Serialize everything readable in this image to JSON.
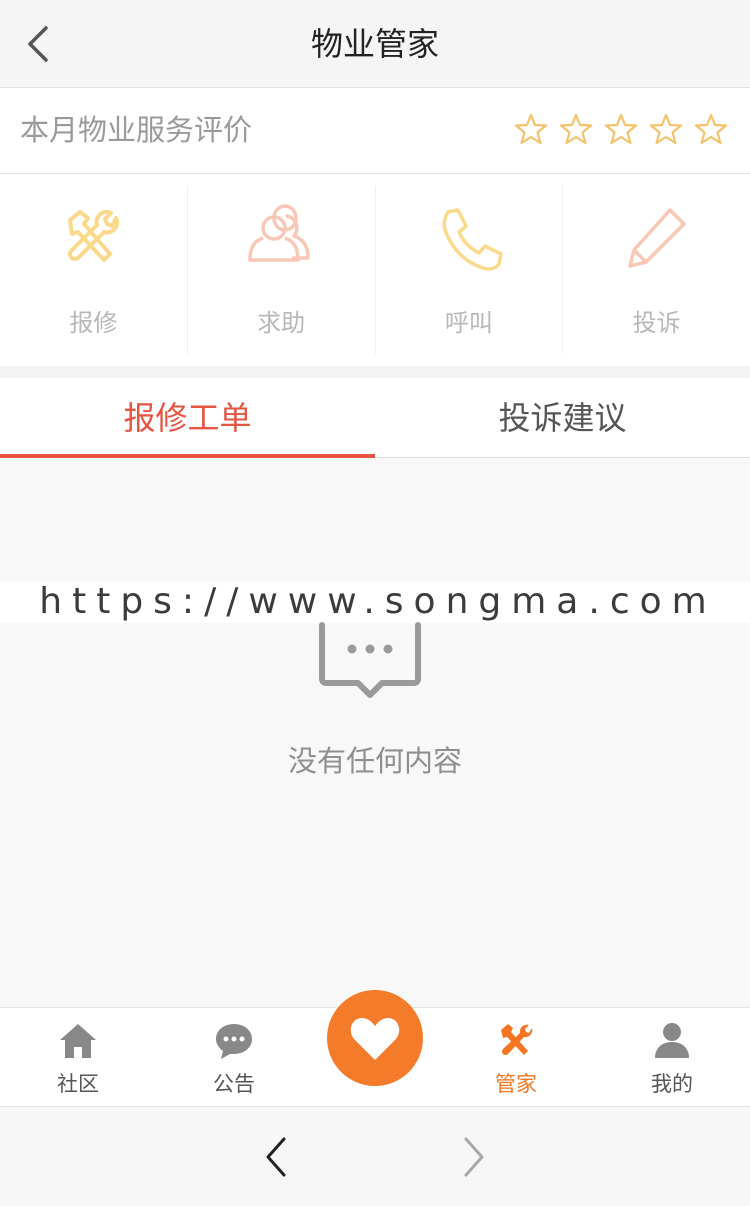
{
  "header": {
    "title": "物业管家",
    "back_icon": "chevron-left-icon"
  },
  "rating": {
    "label": "本月物业服务评价",
    "stars_total": 5,
    "stars_filled": 0,
    "star_color": "#f5c26b"
  },
  "services": [
    {
      "label": "报修",
      "icon": "repair-tools-icon",
      "color": "#fbd98a"
    },
    {
      "label": "求助",
      "icon": "users-icon",
      "color": "#f8c7b5"
    },
    {
      "label": "呼叫",
      "icon": "phone-icon",
      "color": "#fbd98a"
    },
    {
      "label": "投诉",
      "icon": "pencil-icon",
      "color": "#f8c7b5"
    }
  ],
  "tabs": [
    {
      "label": "报修工单",
      "active": true
    },
    {
      "label": "投诉建议",
      "active": false
    }
  ],
  "watermark": "https://www.songma.com",
  "empty_state": {
    "text": "没有任何内容",
    "icon": "message-dots-icon"
  },
  "tabbar": {
    "items": [
      {
        "label": "社区",
        "icon": "home-icon",
        "active": false
      },
      {
        "label": "公告",
        "icon": "chat-bubble-icon",
        "active": false
      },
      {
        "label": "管家",
        "icon": "repair-tools-icon",
        "active": true
      },
      {
        "label": "我的",
        "icon": "person-icon",
        "active": false
      }
    ],
    "center_icon": "heart-icon",
    "accent": "#f47622"
  },
  "browser_nav": {
    "back_icon": "chevron-left-icon",
    "forward_icon": "chevron-right-icon"
  }
}
